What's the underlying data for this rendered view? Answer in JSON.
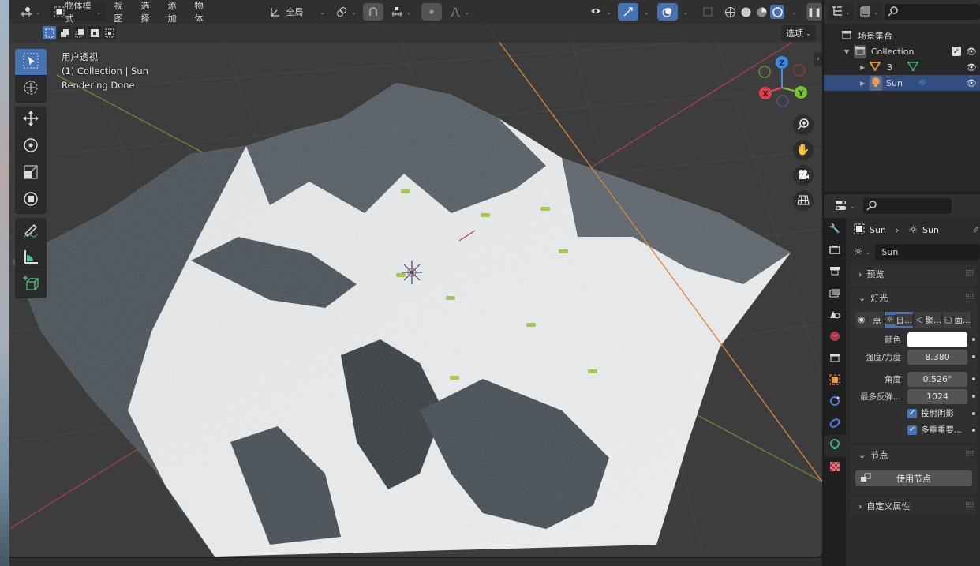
{
  "viewport": {
    "header": {
      "editor_type_icon": "3d-viewport-icon",
      "mode_label": "物体模式",
      "menus": [
        "视图",
        "选择",
        "添加",
        "物体"
      ],
      "transform_orientation": "全局",
      "options_label": "选项"
    },
    "info": {
      "view_name": "用户透视",
      "collection_line": "(1) Collection | Sun",
      "status": "Rendering Done"
    },
    "tools": [
      "select-box",
      "cursor",
      "move",
      "rotate",
      "scale",
      "transform",
      "annotate",
      "measure",
      "add-cube"
    ],
    "gizmo_axes": [
      "Z",
      "X",
      "Y"
    ],
    "accent_color": "#4772b3"
  },
  "outliner": {
    "search_placeholder": "",
    "scene_collection": "场景集合",
    "rows": [
      {
        "label": "Collection",
        "type": "collection"
      },
      {
        "label": "3",
        "type": "mesh"
      },
      {
        "label": "Sun",
        "type": "light",
        "selected": true
      }
    ]
  },
  "properties": {
    "search_placeholder": "",
    "breadcrumb": {
      "object": "Sun",
      "data": "Sun"
    },
    "datablock_name": "Sun",
    "panels": {
      "preview": "预览",
      "light": "灯光",
      "nodes": "节点",
      "custom_props": "自定义属性"
    },
    "light_types": [
      {
        "label": "点",
        "active": false
      },
      {
        "label": "日...",
        "active": true
      },
      {
        "label": "聚...",
        "active": false
      },
      {
        "label": "面...",
        "active": false
      }
    ],
    "fields": {
      "color_label": "颜色",
      "color_value": "#ffffff",
      "strength_label": "强度/力度",
      "strength_value": "8.380",
      "angle_label": "角度",
      "angle_value": "0.526°",
      "max_bounces_label": "最多反弹...",
      "max_bounces_value": "1024",
      "cast_shadow_label": "投射阴影",
      "cast_shadow_checked": true,
      "multiple_importance_label": "多重重要...",
      "multiple_importance_checked": true
    },
    "use_nodes_label": "使用节点"
  }
}
